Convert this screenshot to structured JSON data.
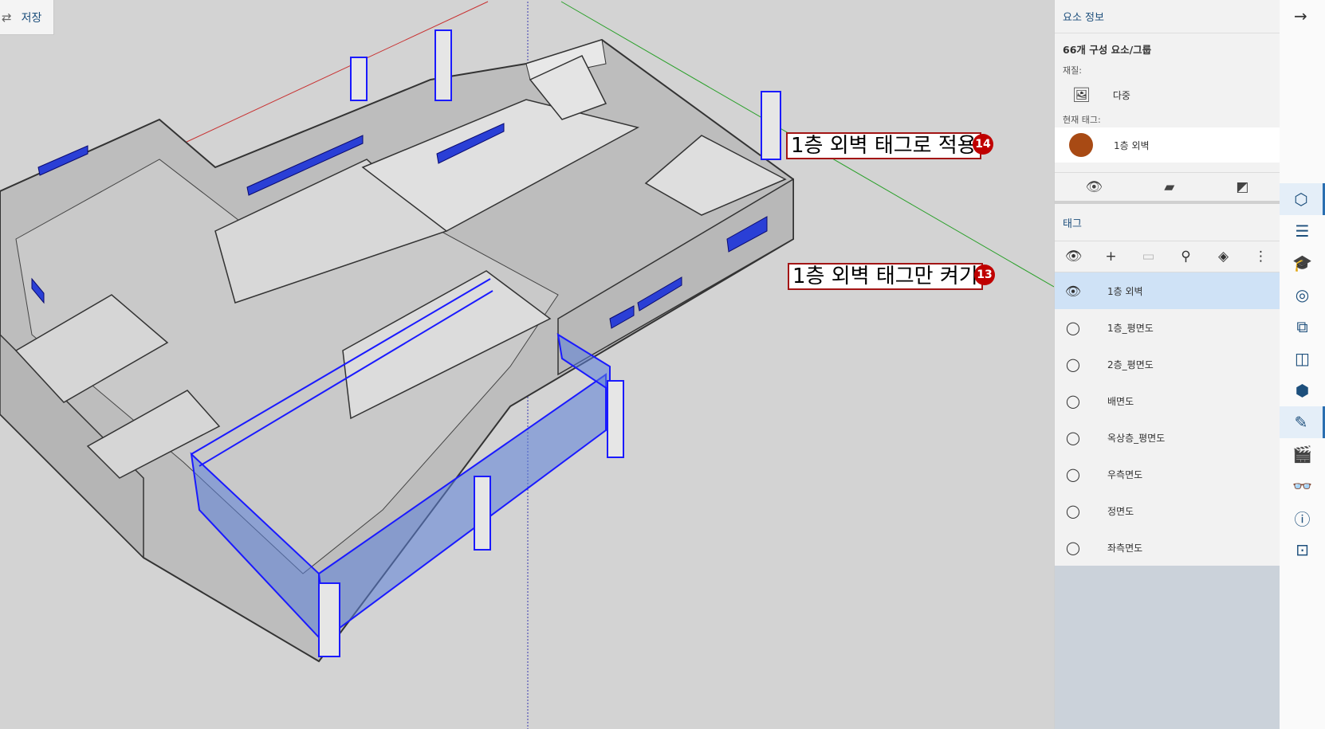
{
  "toolbar": {
    "save_label": "저장",
    "save_icon": "arrow-left-right-icon"
  },
  "callouts": [
    {
      "text": "1층 외벽 태그로 적용",
      "badge": "14"
    },
    {
      "text": "1층 외벽 태그만 켜기",
      "badge": "13"
    }
  ],
  "entity_info": {
    "title": "요소 정보",
    "count_label": "66개 구성 요소/그룹",
    "material_label": "재질:",
    "material_value": "다중",
    "current_tag_label": "현재 태그:",
    "current_tag_value": "1층 외벽",
    "current_tag_color": "#a84a14"
  },
  "tags_panel": {
    "title": "태그",
    "tags": [
      {
        "name": "1층 외벽",
        "selected": true,
        "visible": true
      },
      {
        "name": "1층_평면도",
        "selected": false,
        "visible": false
      },
      {
        "name": "2층_평면도",
        "selected": false,
        "visible": false
      },
      {
        "name": "배면도",
        "selected": false,
        "visible": false
      },
      {
        "name": "옥상층_평면도",
        "selected": false,
        "visible": false
      },
      {
        "name": "우측면도",
        "selected": false,
        "visible": false
      },
      {
        "name": "정면도",
        "selected": false,
        "visible": false
      },
      {
        "name": "좌측면도",
        "selected": false,
        "visible": false
      }
    ]
  },
  "colors": {
    "selection_blue": "#1a1aff",
    "axis_red": "#c83232",
    "axis_green": "#2aa02a",
    "accent": "#1d4f7c"
  }
}
